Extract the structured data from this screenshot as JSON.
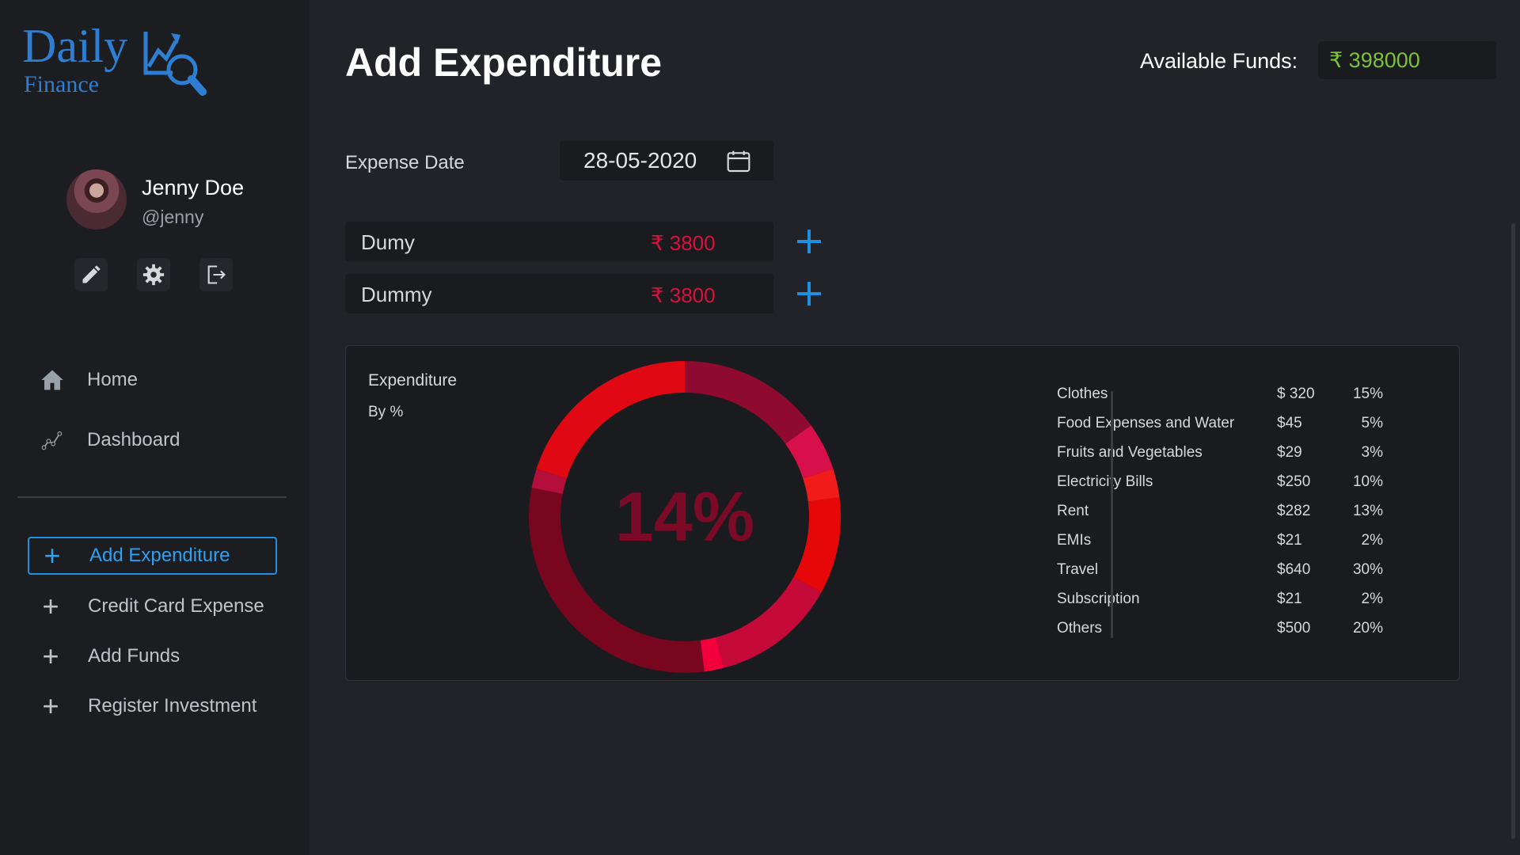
{
  "app": {
    "logo_top": "Daily",
    "logo_bottom": "Finance",
    "brand_color": "#2e7fd3",
    "accent_color": "#1f90e0"
  },
  "profile": {
    "name": "Jenny Doe",
    "handle": "@jenny",
    "actions": [
      {
        "icon": "pencil-icon"
      },
      {
        "icon": "gear-icon"
      },
      {
        "icon": "logout-icon"
      }
    ]
  },
  "nav": {
    "items": [
      {
        "label": "Home",
        "icon": "home-icon"
      },
      {
        "label": "Dashboard",
        "icon": "chart-line-icon"
      }
    ]
  },
  "menu": {
    "items": [
      {
        "label": "Add Expenditure",
        "active": true
      },
      {
        "label": "Credit Card Expense",
        "active": false
      },
      {
        "label": "Add Funds",
        "active": false
      },
      {
        "label": "Register Investment",
        "active": false
      }
    ]
  },
  "header": {
    "title": "Add Expenditure",
    "funds_label": "Available Funds:",
    "funds_value": "₹ 398000",
    "funds_color": "#7dc13a"
  },
  "form": {
    "date_label": "Expense Date",
    "date_value": "28-05-2020",
    "rows": [
      {
        "name": "Dumy",
        "amount": "₹ 3800"
      },
      {
        "name": "Dummy",
        "amount": "₹ 3800"
      }
    ],
    "amount_color": "#d8123c"
  },
  "chart": {
    "title": "Expenditure",
    "subtitle": "By %",
    "center_label": "14%"
  },
  "chart_data": {
    "type": "pie",
    "categories": [
      "Clothes",
      "Food Expenses and Water",
      "Fruits and Vegetables",
      "Electricity Bills",
      "Rent",
      "EMIs",
      "Travel",
      "Subscription",
      "Others"
    ],
    "amounts": [
      "$ 320",
      "$45",
      "$29",
      "$250",
      "$282",
      "$21",
      "$640",
      "$21",
      "$500"
    ],
    "percent_labels": [
      "15%",
      "5%",
      "3%",
      "10%",
      "13%",
      "2%",
      "30%",
      "2%",
      "20%"
    ],
    "values": [
      15,
      5,
      3,
      10,
      13,
      2,
      30,
      2,
      20
    ],
    "colors": [
      "#8e0a2e",
      "#d8104a",
      "#f01c1c",
      "#e60808",
      "#c50a3a",
      "#f2003c",
      "#78061f",
      "#b30f3a",
      "#e00812"
    ]
  }
}
